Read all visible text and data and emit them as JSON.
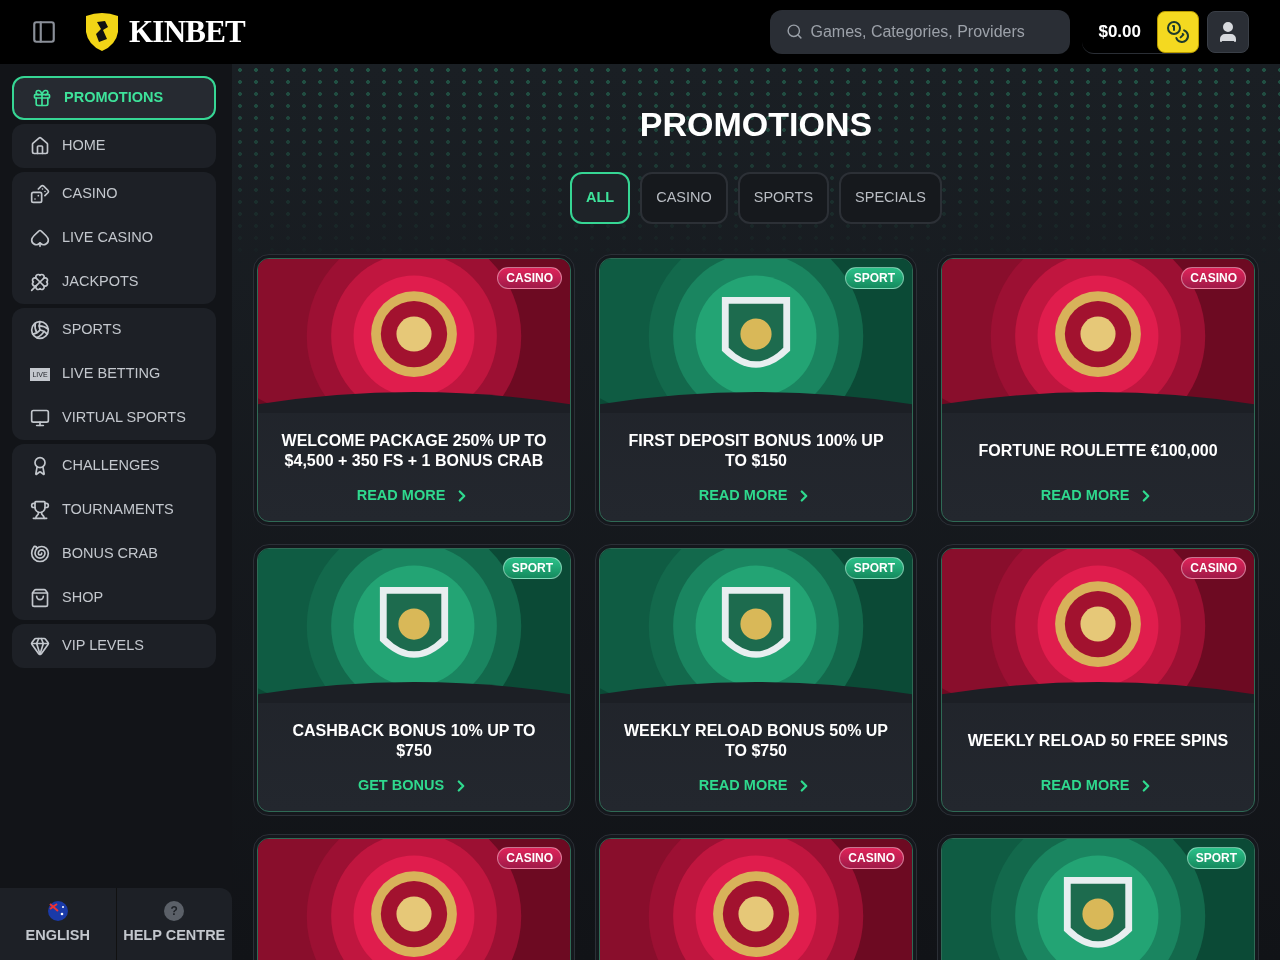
{
  "header": {
    "logo": "KINBET",
    "search": {
      "placeholder": "Games, Categories, Providers"
    },
    "balance": "$0.00"
  },
  "sidebar": {
    "groups": [
      {
        "items": [
          {
            "label": "PROMOTIONS",
            "selected": true
          }
        ]
      },
      {
        "items": [
          {
            "label": "HOME",
            "selected": false
          }
        ]
      },
      {
        "items": [
          {
            "label": "CASINO",
            "selected": false
          },
          {
            "label": "LIVE CASINO",
            "selected": false
          },
          {
            "label": "JACKPOTS",
            "selected": false
          }
        ]
      },
      {
        "items": [
          {
            "label": "SPORTS",
            "selected": false
          },
          {
            "label": "LIVE BETTING",
            "icon_text": "LIVE",
            "selected": false
          },
          {
            "label": "VIRTUAL SPORTS",
            "selected": false
          }
        ]
      },
      {
        "items": [
          {
            "label": "CHALLENGES",
            "selected": false
          },
          {
            "label": "TOURNAMENTS",
            "selected": false
          },
          {
            "label": "BONUS CRAB",
            "selected": false
          },
          {
            "label": "SHOP",
            "selected": false
          }
        ]
      },
      {
        "items": [
          {
            "label": "VIP LEVELS",
            "selected": false
          }
        ]
      }
    ],
    "footer": {
      "language": "ENGLISH",
      "help_icon": "?",
      "help": "HELP CENTRE"
    }
  },
  "page": {
    "title": "PROMOTIONS",
    "tabs": [
      {
        "label": "ALL",
        "selected": true
      },
      {
        "label": "CASINO",
        "selected": false
      },
      {
        "label": "SPORTS",
        "selected": false
      },
      {
        "label": "SPECIALS",
        "selected": false
      }
    ],
    "cards": [
      {
        "kind": "casino",
        "badge": "CASINO",
        "title": "WELCOME PACKAGE 250% UP TO $4,500 + 350 FS + 1 BONUS CRAB",
        "link": "READ MORE"
      },
      {
        "kind": "sport",
        "badge": "SPORT",
        "title": "FIRST DEPOSIT BONUS 100% UP TO $150",
        "link": "READ MORE"
      },
      {
        "kind": "casino",
        "badge": "CASINO",
        "title": "FORTUNE ROULETTE €100,000",
        "link": "READ MORE"
      },
      {
        "kind": "sport",
        "badge": "SPORT",
        "title": "CASHBACK BONUS 10% UP TO $750",
        "link": "GET BONUS"
      },
      {
        "kind": "sport",
        "badge": "SPORT",
        "title": "WEEKLY RELOAD BONUS 50% UP TO $750",
        "link": "READ MORE"
      },
      {
        "kind": "casino",
        "badge": "CASINO",
        "title": "WEEKLY RELOAD 50 FREE SPINS",
        "link": "READ MORE"
      },
      {
        "kind": "casino",
        "badge": "CASINO"
      },
      {
        "kind": "casino",
        "badge": "CASINO"
      },
      {
        "kind": "sport",
        "badge": "SPORT"
      }
    ]
  }
}
